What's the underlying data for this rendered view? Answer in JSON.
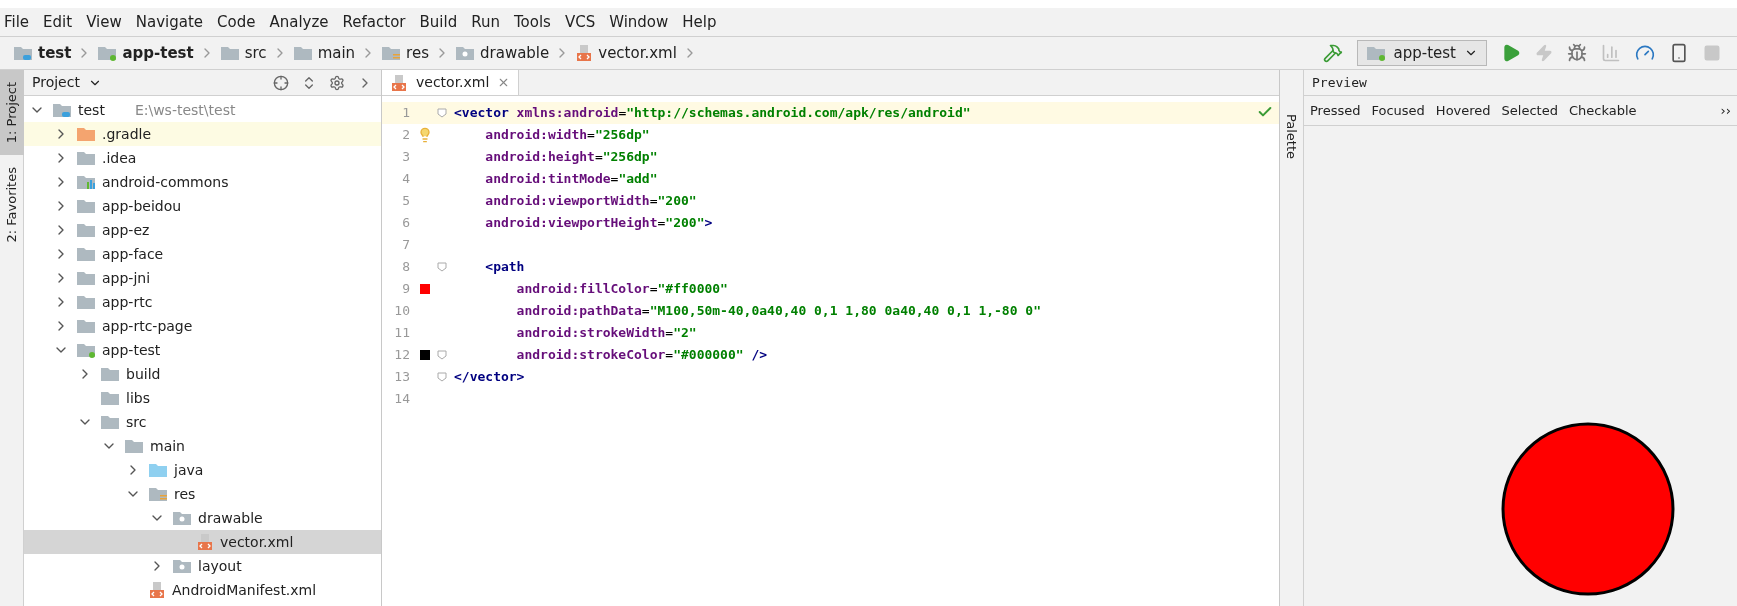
{
  "menu": [
    "File",
    "Edit",
    "View",
    "Navigate",
    "Code",
    "Analyze",
    "Refactor",
    "Build",
    "Run",
    "Tools",
    "VCS",
    "Window",
    "Help"
  ],
  "breadcrumbs": [
    {
      "label": "test",
      "kind": "project"
    },
    {
      "label": "app-test",
      "kind": "module"
    },
    {
      "label": "src",
      "kind": "folder"
    },
    {
      "label": "main",
      "kind": "folder"
    },
    {
      "label": "res",
      "kind": "res"
    },
    {
      "label": "drawable",
      "kind": "package"
    },
    {
      "label": "vector.xml",
      "kind": "xml"
    }
  ],
  "run_config": "app-test",
  "side_tabs": [
    {
      "label": "1: Project",
      "selected": true
    },
    {
      "label": "2: Favorites",
      "selected": false
    }
  ],
  "project_panel": {
    "title": "Project",
    "tree": [
      {
        "label": "test",
        "path": "E:\\ws-test\\test",
        "kind": "project",
        "expanded": true,
        "selected": false,
        "children": [
          {
            "label": ".gradle",
            "kind": "folder-orange",
            "expanded": false,
            "selected": false,
            "highlighted": true
          },
          {
            "label": ".idea",
            "kind": "folder",
            "expanded": false,
            "selected": false
          },
          {
            "label": "android-commons",
            "kind": "library",
            "expanded": false,
            "selected": false
          },
          {
            "label": "app-beidou",
            "kind": "folder",
            "expanded": false,
            "selected": false
          },
          {
            "label": "app-ez",
            "kind": "folder",
            "expanded": false,
            "selected": false
          },
          {
            "label": "app-face",
            "kind": "folder",
            "expanded": false,
            "selected": false
          },
          {
            "label": "app-jni",
            "kind": "folder",
            "expanded": false,
            "selected": false
          },
          {
            "label": "app-rtc",
            "kind": "folder",
            "expanded": false,
            "selected": false
          },
          {
            "label": "app-rtc-page",
            "kind": "folder",
            "expanded": false,
            "selected": false
          },
          {
            "label": "app-test",
            "kind": "module",
            "expanded": true,
            "selected": false,
            "children": [
              {
                "label": "build",
                "kind": "folder",
                "expanded": false,
                "selected": false
              },
              {
                "label": "libs",
                "kind": "folder",
                "selected": false
              },
              {
                "label": "src",
                "kind": "folder",
                "expanded": true,
                "selected": false,
                "children": [
                  {
                    "label": "main",
                    "kind": "folder",
                    "expanded": true,
                    "selected": false,
                    "children": [
                      {
                        "label": "java",
                        "kind": "folder-blue",
                        "expanded": false,
                        "selected": false
                      },
                      {
                        "label": "res",
                        "kind": "res",
                        "expanded": true,
                        "selected": false,
                        "children": [
                          {
                            "label": "drawable",
                            "kind": "package",
                            "expanded": true,
                            "selected": false,
                            "children": [
                              {
                                "label": "vector.xml",
                                "kind": "xml",
                                "selected": true
                              }
                            ]
                          },
                          {
                            "label": "layout",
                            "kind": "package",
                            "expanded": false,
                            "selected": false
                          }
                        ]
                      },
                      {
                        "label": "AndroidManifest.xml",
                        "kind": "manifest",
                        "selected": false
                      }
                    ]
                  }
                ]
              }
            ]
          }
        ]
      }
    ]
  },
  "editor": {
    "tab": {
      "label": "vector.xml",
      "selected": true
    },
    "lines": [
      {
        "number": "1",
        "current": true,
        "fold": true,
        "tokens": [
          {
            "kind": "tag",
            "text": "<vector"
          },
          {
            "kind": "attr",
            "text": " xmlns:android"
          },
          {
            "kind": "punct",
            "text": "="
          },
          {
            "kind": "value",
            "text": "\"http://schemas.android.com/apk/res/android\""
          }
        ]
      },
      {
        "number": "2",
        "current": false,
        "fold": false,
        "marker": {
          "kind": "bulb"
        },
        "tokens": [
          {
            "kind": "attr",
            "text": "    android:width"
          },
          {
            "kind": "punct",
            "text": "="
          },
          {
            "kind": "value",
            "text": "\"256dp\""
          }
        ]
      },
      {
        "number": "3",
        "current": false,
        "fold": false,
        "tokens": [
          {
            "kind": "attr",
            "text": "    android:height"
          },
          {
            "kind": "punct",
            "text": "="
          },
          {
            "kind": "value",
            "text": "\"256dp\""
          }
        ]
      },
      {
        "number": "4",
        "current": false,
        "fold": false,
        "tokens": [
          {
            "kind": "attr",
            "text": "    android:tintMode"
          },
          {
            "kind": "punct",
            "text": "="
          },
          {
            "kind": "value",
            "text": "\"add\""
          }
        ]
      },
      {
        "number": "5",
        "current": false,
        "fold": false,
        "tokens": [
          {
            "kind": "attr",
            "text": "    android:viewportWidth"
          },
          {
            "kind": "punct",
            "text": "="
          },
          {
            "kind": "value",
            "text": "\"200\""
          }
        ]
      },
      {
        "number": "6",
        "current": false,
        "fold": false,
        "tokens": [
          {
            "kind": "attr",
            "text": "    android:viewportHeight"
          },
          {
            "kind": "punct",
            "text": "="
          },
          {
            "kind": "value",
            "text": "\"200\""
          },
          {
            "kind": "tag",
            "text": ">"
          }
        ]
      },
      {
        "number": "7",
        "current": false,
        "fold": false
      },
      {
        "number": "8",
        "current": false,
        "fold": true,
        "tokens": [
          {
            "kind": "tag",
            "text": "    <path"
          }
        ]
      },
      {
        "number": "9",
        "current": false,
        "fold": false,
        "marker": {
          "kind": "swatch",
          "color": "#ff0000"
        },
        "tokens": [
          {
            "kind": "attr",
            "text": "        android:fillColor"
          },
          {
            "kind": "punct",
            "text": "="
          },
          {
            "kind": "value",
            "text": "\"#ff0000\""
          }
        ]
      },
      {
        "number": "10",
        "current": false,
        "fold": false,
        "tokens": [
          {
            "kind": "attr",
            "text": "        android:pathData"
          },
          {
            "kind": "punct",
            "text": "="
          },
          {
            "kind": "value",
            "text": "\"M100,50m-40,0a40,40 0,1 1,80 0a40,40 0,1 1,-80 0\""
          }
        ]
      },
      {
        "number": "11",
        "current": false,
        "fold": false,
        "tokens": [
          {
            "kind": "attr",
            "text": "        android:strokeWidth"
          },
          {
            "kind": "punct",
            "text": "="
          },
          {
            "kind": "value",
            "text": "\"2\""
          }
        ]
      },
      {
        "number": "12",
        "current": false,
        "fold": true,
        "marker": {
          "kind": "swatch",
          "color": "#000000"
        },
        "tokens": [
          {
            "kind": "attr",
            "text": "        android:strokeColor"
          },
          {
            "kind": "punct",
            "text": "="
          },
          {
            "kind": "value",
            "text": "\"#000000\""
          },
          {
            "kind": "tag",
            "text": " />"
          }
        ]
      },
      {
        "number": "13",
        "current": false,
        "fold": true,
        "tokens": [
          {
            "kind": "tag",
            "text": "</vector>"
          }
        ]
      },
      {
        "number": "14",
        "current": false,
        "fold": false
      }
    ]
  },
  "right_tabs": [
    {
      "label": "Palette",
      "selected": false
    }
  ],
  "preview": {
    "title": "Preview",
    "states": [
      {
        "label": "Pressed",
        "selected": false
      },
      {
        "label": "Focused",
        "selected": false
      },
      {
        "label": "Hovered",
        "selected": false
      },
      {
        "label": "Selected",
        "selected": false
      },
      {
        "label": "Checkable",
        "selected": false
      }
    ],
    "more": "››"
  }
}
